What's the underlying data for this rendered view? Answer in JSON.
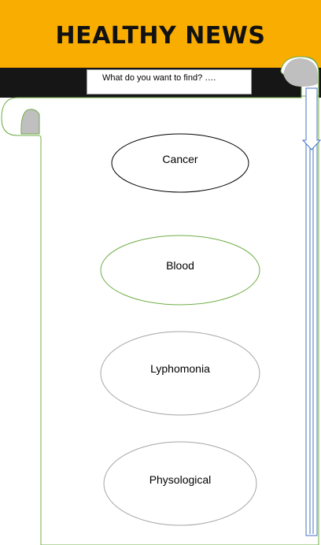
{
  "header": {
    "title": "HEALTHY NEWS"
  },
  "search": {
    "placeholder": "What do you want to find? …."
  },
  "topics": [
    {
      "label": "Cancer"
    },
    {
      "label": "Blood"
    },
    {
      "label": "Lyphomonia"
    },
    {
      "label": "Physological"
    }
  ],
  "colors": {
    "header_bg": "#f9ad00",
    "dark_bar": "#161616",
    "scroll_outline": "#70ad47",
    "scrollbar": "#4472c4",
    "curl_fill": "#bfbfbf"
  }
}
